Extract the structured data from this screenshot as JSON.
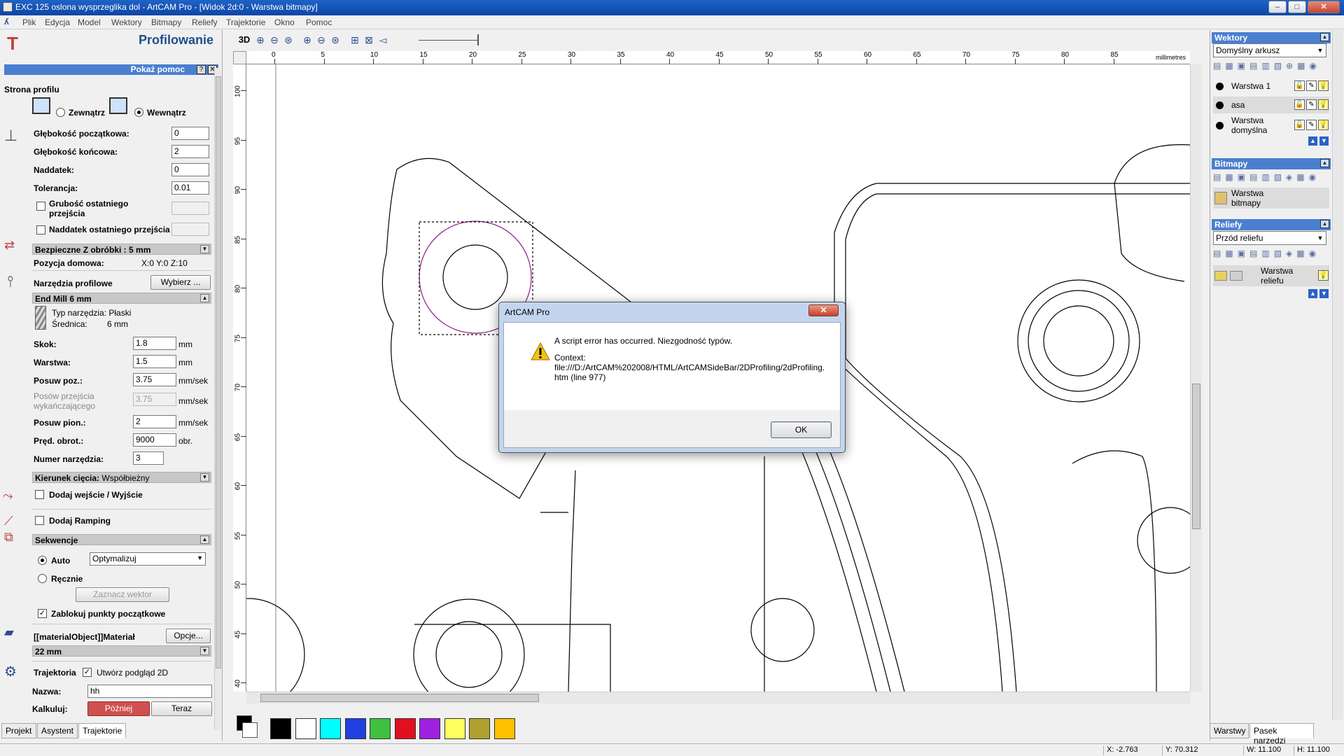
{
  "window": {
    "title": "EXC 125 oslona wysprzeglika dol - ArtCAM Pro - [Widok 2d:0 - Warstwa bitmapy]"
  },
  "menu": [
    "Plik",
    "Edycja",
    "Model",
    "Wektory",
    "Bitmapy",
    "Reliefy",
    "Trajektorie",
    "Okno",
    "Pomoc"
  ],
  "left_panel": {
    "title": "Profilowanie",
    "help_label": "Pokaż pomoc",
    "help_q": "?",
    "help_x": "✕",
    "side_heading": "Strona profilu",
    "outside_label": "Zewnątrz",
    "inside_label": "Wewnątrz",
    "start_depth_label": "Głębokość początkowa:",
    "start_depth": "0",
    "end_depth_label": "Głębokość końcowa:",
    "end_depth": "2",
    "allowance_label": "Naddatek:",
    "allowance": "0",
    "tolerance_label": "Tolerancja:",
    "tolerance": "0.01",
    "last_pass_thickness_label": "Grubość ostatniego przejścia",
    "last_pass_allowance_label": "Naddatek ostatniego przejścia",
    "safe_z_label": "Bezpieczne Z obróbki : 5 mm",
    "home_position_label": "Pozycja domowa:",
    "home_position": "X:0 Y:0 Z:10",
    "profile_tools_label": "Narzędzia profilowe",
    "choose_button": "Wybierz ...",
    "tool_name": "End Mill 6 mm",
    "tool_type": "Typ narzędzia: Płaski",
    "tool_diameter_label": "Średnica:",
    "tool_diameter": "6 mm",
    "stepover_label": "Skok:",
    "stepover": "1.8",
    "stepdown_label": "Warstwa:",
    "stepdown": "1.5",
    "feed_label": "Posuw poz.:",
    "feed": "3.75",
    "finish_feed_label": "Posów przejścia wykańczającego",
    "finish_feed": "3.75",
    "plunge_label": "Posuw pion.:",
    "plunge": "2",
    "spindle_label": "Pręd. obrot.:",
    "spindle": "9000",
    "tool_number_label": "Numer narzędzia:",
    "tool_number": "3",
    "unit_mm": "mm",
    "unit_mmsek": "mm/sek",
    "unit_obr": "obr.",
    "cut_direction_label": "Kierunek cięcia:",
    "cut_direction": "Współbieżny",
    "lead_in_out_label": "Dodaj wejście / Wyjście",
    "ramping_label": "Dodaj Ramping",
    "sequence_label": "Sekwencje",
    "auto_label": "Auto",
    "auto_option": "Optymalizuj",
    "manual_label": "Ręcznie",
    "select_vector_button": "Zaznacz wektor",
    "lock_start_points_label": "Zablokuj punkty początkowe",
    "material_label": "[[materialObject]]Materiał",
    "options_button": "Opcje...",
    "material_thickness": "22 mm",
    "toolpath_label": "Trajektoria",
    "preview_2d_label": "Utwórz podgląd 2D",
    "name_label": "Nazwa:",
    "name_value": "hh",
    "calculate_label": "Kalkuluj:",
    "later_button": "Później",
    "now_button": "Teraz"
  },
  "view": {
    "mode_3d": "3D",
    "ruler_unit": "millimetres",
    "x_ticks": [
      "0",
      "5",
      "10",
      "15",
      "20",
      "25",
      "30",
      "35",
      "40",
      "45",
      "50",
      "55",
      "60",
      "65",
      "70",
      "75",
      "80",
      "85"
    ],
    "y_ticks": [
      "100",
      "95",
      "90",
      "85",
      "80",
      "75",
      "70",
      "65",
      "60",
      "55",
      "50",
      "45",
      "40"
    ]
  },
  "palette": {
    "colors": [
      "#000000",
      "#ffffff",
      "#00ffff",
      "#2040e0",
      "#40c040",
      "#e01020",
      "#a020e0",
      "#ffff60",
      "#b0a030",
      "#ffc000"
    ]
  },
  "right_panel": {
    "vectors_header": "Wektory",
    "vectors_sheet": "Domyślny arkusz",
    "vector_layers": [
      "Warstwa 1",
      "asa",
      "Warstwa domyślna"
    ],
    "bitmaps_header": "Bitmapy",
    "bitmap_layer": "Warstwa bitmapy",
    "reliefs_header": "Reliefy",
    "relief_view": "Przód reliefu",
    "relief_layer": "Warstwa reliefu"
  },
  "bottom_tabs": {
    "left": [
      "Projekt",
      "Asystent",
      "Trajektorie"
    ],
    "right": [
      "Warstwy",
      "Pasek narzędzi"
    ]
  },
  "status": {
    "x": "X: -2.763",
    "y": "Y: 70.312",
    "w": "W: 11.100",
    "h": "H: 11.100"
  },
  "dialog": {
    "title": "ArtCAM Pro",
    "message": "A script error has occurred. Niezgodność typów.",
    "context_label": "Context:",
    "context_text": "file:///D:/ArtCAM%202008/HTML/ArtCAMSideBar/2DProfiling/2dProfiling.htm (line 977)",
    "ok": "OK"
  }
}
